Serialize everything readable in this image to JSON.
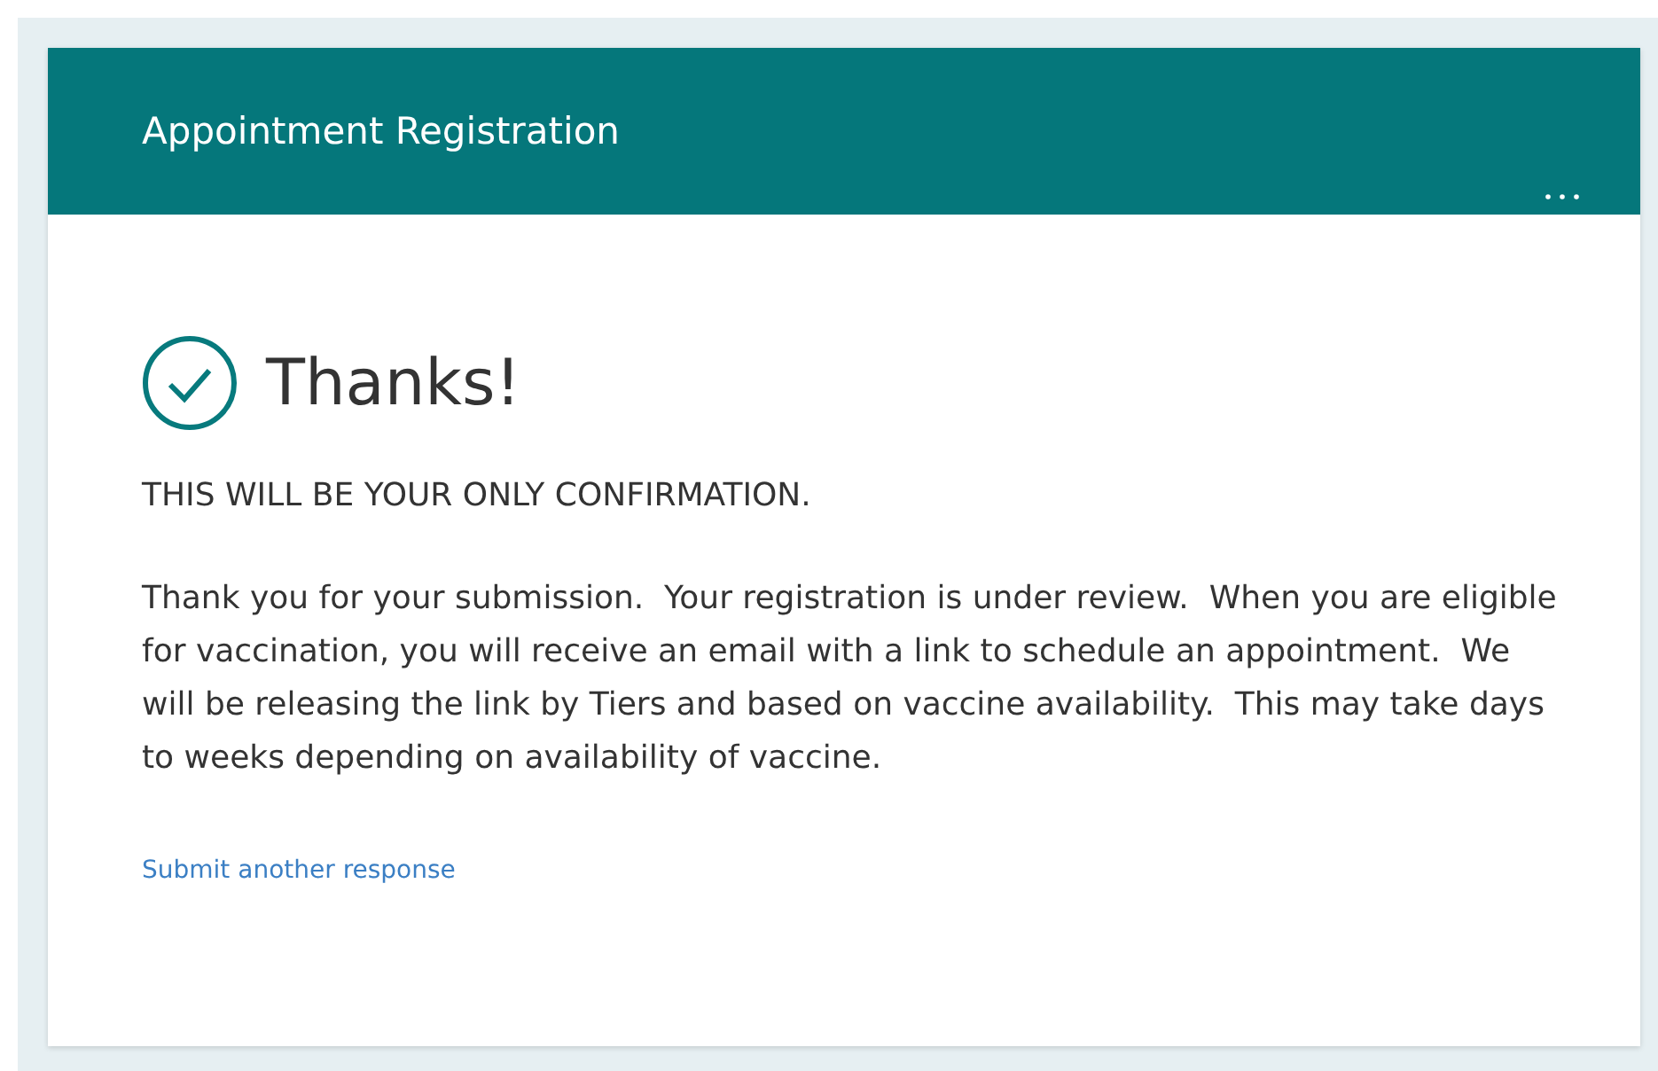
{
  "header": {
    "title": "Appointment Registration"
  },
  "confirmation": {
    "heading": "Thanks!",
    "notice": "THIS WILL BE YOUR ONLY CONFIRMATION.",
    "message": "Thank you for your submission.  Your registration is under review.  When you are eligible for vaccination, you will receive an email with a link to schedule an appointment.  We will be releasing the link by Tiers and based on vaccine availability.  This may take days to weeks depending on availability of vaccine.",
    "link": "Submit another response"
  }
}
